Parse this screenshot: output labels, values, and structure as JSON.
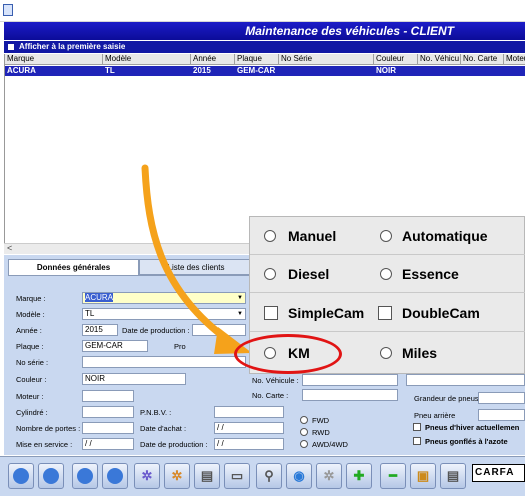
{
  "window": {
    "title": ""
  },
  "header": {
    "title": "Maintenance des véhicules - CLIENT"
  },
  "show_first": {
    "label": "Afficher à la première saisie"
  },
  "grid": {
    "columns": [
      "Marque",
      "Modèle",
      "Année",
      "Plaque",
      "No Série",
      "Couleur",
      "No. Véhicu",
      "No. Carte",
      "Moteur"
    ],
    "rows": [
      {
        "marque": "ACURA",
        "modele": "TL",
        "annee": "2015",
        "plaque": "GEM-CAR",
        "serie": "",
        "couleur": "NOIR",
        "vehicule": "",
        "carte": "",
        "moteur": ""
      }
    ]
  },
  "scroll": {
    "left_arrow": "<"
  },
  "tabs": {
    "general": "Données générales",
    "clients": "Liste des clients"
  },
  "form": {
    "marque_label": "Marque :",
    "marque_value": "ACURA",
    "modele_label": "Modèle :",
    "modele_value": "TL",
    "annee_label": "Année :",
    "annee_value": "2015",
    "date_production_label": "Date de production :",
    "plaque_label": "Plaque :",
    "plaque_value": "GEM-CAR",
    "pro_label": "Pro",
    "serie_label": "No série :",
    "couleur_label": "Couleur :",
    "couleur_value": "NOIR",
    "moteur_label": "Moteur :",
    "vehicule_label": "No. Véhicule :",
    "carte_label": "No. Carte :",
    "cylindre_label": "Cylindré :",
    "pnbv_label": "P.N.B.V. :",
    "portes_label": "Nombre de portes :",
    "achat_label": "Date d'achat :",
    "achat_value": "/ /",
    "service_label": "Mise en service :",
    "service_value": "/ /",
    "production_label2": "Date de production :",
    "production_value2": "/ /",
    "drive_fwd": "FWD",
    "drive_rwd": "RWD",
    "drive_awd": "AWD/4WD",
    "tire_size_label": "Grandeur de pneus",
    "rear_tire_label": "Pneu arrière",
    "winter_tires_label": "Pneus d'hiver actuellemen",
    "nitrogen_label": "Pneus gonflés à l'azote"
  },
  "overlay": {
    "manual": "Manuel",
    "automatic": "Automatique",
    "diesel": "Diesel",
    "essence": "Essence",
    "simplecam": "SimpleCam",
    "doublecam": "DoubleCam",
    "km": "KM",
    "miles": "Miles"
  },
  "toolbar": {
    "carfax": "CARFA"
  },
  "colors": {
    "header_blue": "#1c1cc8",
    "selection_blue": "#1f24b8",
    "form_bg": "#c9d8f0",
    "arrow_orange": "#f5a21b",
    "highlight_red": "#e11414",
    "yellow_input": "#ffffc8"
  }
}
